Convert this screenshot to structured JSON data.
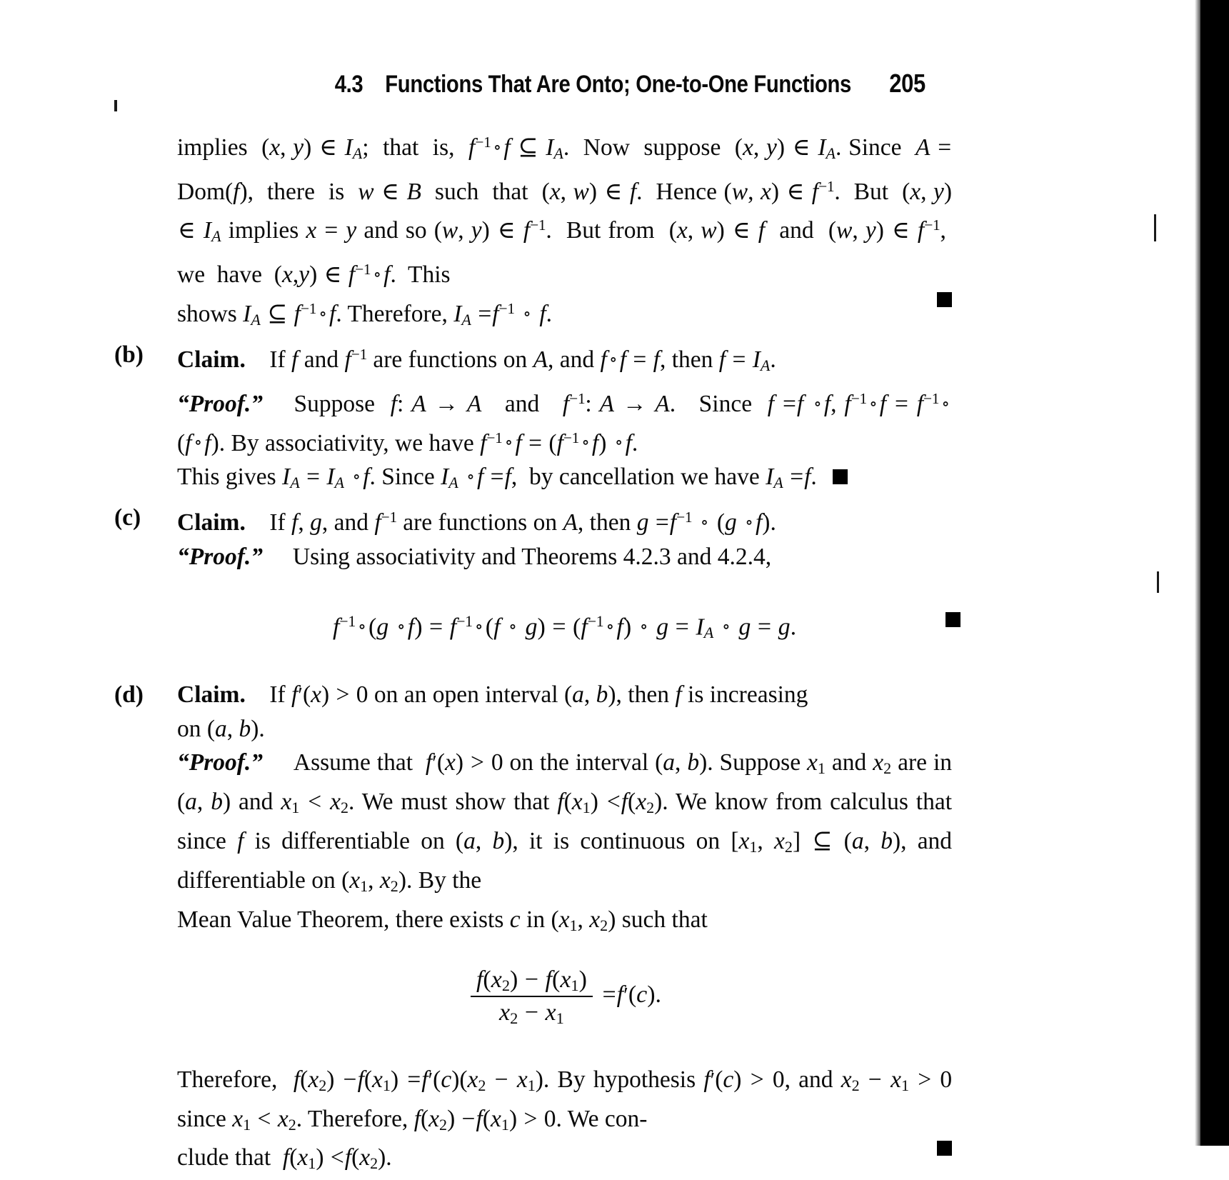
{
  "page": {
    "running_head": {
      "section_number": "4.3",
      "section_title": "Functions That Are Onto; One-to-One Functions",
      "page_number": "205"
    },
    "background_color": "#ffffff",
    "text_color": "#0a0a0a",
    "gutter_color": "#000000"
  },
  "content": {
    "intro_paragraph": {
      "line1_a": "implies",
      "line1_b": "(x, y) ∈ I",
      "line1_sub": "A",
      "line1_c": "; that is, f",
      "line1_sup": "−1",
      "line1_d": "∘ f ⊆ I",
      "line1_e": ". Now suppose (x, y) ∈ I",
      "full_text": "implies (x, y) ∈ I_A; that is, f^−1 ∘ f ⊆ I_A. Now suppose (x, y) ∈ I_A. Since A = Dom( f ), there is w ∈ B such that (x, w) ∈ f. Hence (w, x) ∈ f^−1. But (x, y) ∈ I_A implies x = y and so (w, y) ∈ f^−1. But from (x, w) ∈ f and (w, y) ∈ f^−1, we have (x,y) ∈ f^−1 ∘ f. This shows I_A ⊆ f^−1 ∘ f. Therefore, I_A = f^−1 ∘ f."
    },
    "items": [
      {
        "label": "(b)",
        "claim_word": "Claim.",
        "claim_text": "If f and f^−1 are functions on A, and f ∘ f = f, then f = I_A.",
        "proof_word": "“Proof.”",
        "proof_text": "Suppose f : A → A and f^−1 : A → A. Since f = f ∘ f, f^−1 ∘ f = f^−1 ∘ ( f ∘ f ). By associativity, we have f^−1 ∘ f = ( f^−1 ∘ f ) ∘ f. This gives I_A = I_A ∘ f. Since I_A ∘ f = f, by cancellation we have I_A = f.",
        "qed": "■"
      },
      {
        "label": "(c)",
        "claim_word": "Claim.",
        "claim_text": "If f, g, and f^−1 are functions on A, then g = f^−1 ∘ ( g ∘ f ).",
        "proof_word": "“Proof.”",
        "proof_text": "Using associativity and Theorems 4.2.3 and 4.2.4,",
        "display_equation": "f^−1 ∘ ( g ∘ f ) = f^−1 ∘ ( f ∘ g ) = ( f^−1 ∘ f ) ∘ g = I_A ∘ g = g.",
        "qed": "■"
      },
      {
        "label": "(d)",
        "claim_word": "Claim.",
        "claim_text": "If f′(x) > 0 on an open interval (a, b), then f is increasing on (a, b).",
        "proof_word": "“Proof.”",
        "proof_text": "Assume that f′(x) > 0 on the interval (a, b). Suppose x_1 and x_2 are in (a, b) and x_1 < x_2. We must show that f (x_1) < f (x_2). We know from calculus that since f is differentiable on (a, b), it is continuous on [x_1, x_2] ⊆ (a, b), and differentiable on (x_1, x_2). By the Mean Value Theorem, there exists c in (x_1, x_2) such that",
        "display_fraction": {
          "numerator": "f (x_2) − f (x_1)",
          "denominator": "x_2 − x_1",
          "equals": "= f′(c)."
        },
        "closing_text": "Therefore, f (x_2) − f (x_1) = f′(c)(x_2 − x_1). By hypothesis f′(c) > 0, and x_2 − x_1 > 0 since x_1 < x_2. Therefore, f (x_2) − f (x_1) > 0. We conclude that f (x_1) < f (x_2).",
        "qed": "■"
      }
    ]
  },
  "glyphs": {
    "elem": "∈",
    "subseteq": "⊆",
    "compose": "∘",
    "arrow": "→",
    "minus": "−",
    "qed_box": "■"
  }
}
